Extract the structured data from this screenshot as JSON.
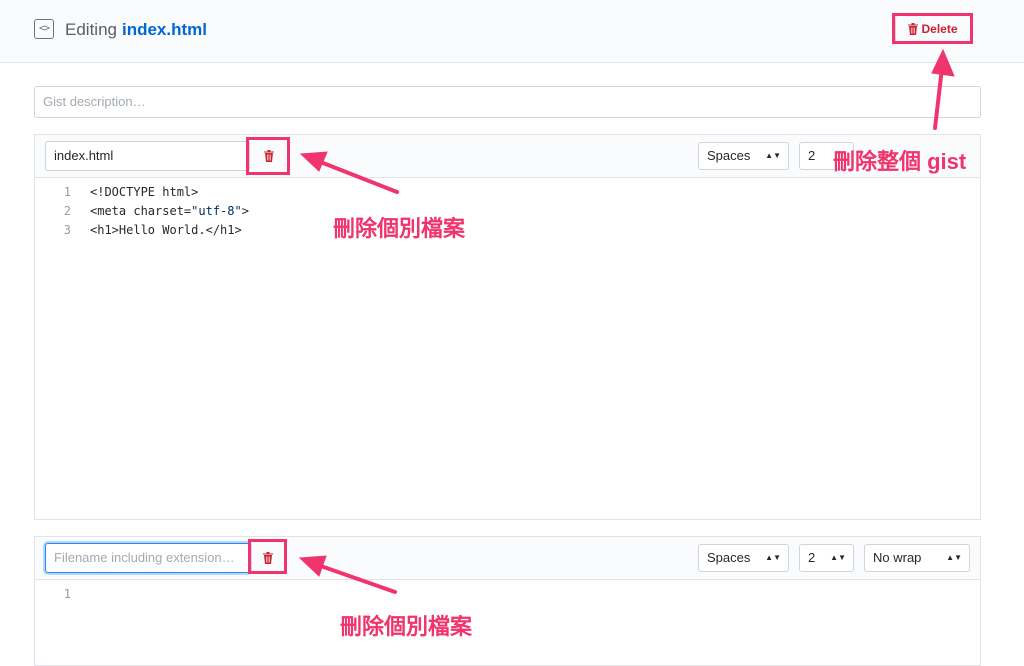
{
  "header": {
    "icon": "code-icon",
    "title_prefix": "Editing",
    "filename": "index.html",
    "delete_label": "Delete"
  },
  "description": {
    "placeholder": "Gist description…"
  },
  "files": [
    {
      "filename": "index.html",
      "indent_mode": "Spaces",
      "indent_size": "2",
      "lines": [
        {
          "num": "1",
          "parts": [
            {
              "t": "<!DOCTYPE html>",
              "k": ""
            }
          ]
        },
        {
          "num": "2",
          "parts": [
            {
              "t": "<meta charset=",
              "k": ""
            },
            {
              "t": "\"utf-8\"",
              "k": "str"
            },
            {
              "t": ">",
              "k": ""
            }
          ]
        },
        {
          "num": "3",
          "parts": [
            {
              "t": "<h1>Hello World.</h1>",
              "k": ""
            }
          ]
        }
      ]
    },
    {
      "filename_placeholder": "Filename including extension…",
      "indent_mode": "Spaces",
      "indent_size": "2",
      "wrap_mode": "No wrap",
      "lines": [
        {
          "num": "1",
          "parts": []
        }
      ]
    }
  ],
  "annotations": {
    "delete_gist": "刪除整個 gist",
    "delete_file_1": "刪除個別檔案",
    "delete_file_2": "刪除個別檔案"
  },
  "colors": {
    "annotation": "#f0346e",
    "link": "#0366d6",
    "danger": "#cb2431"
  }
}
